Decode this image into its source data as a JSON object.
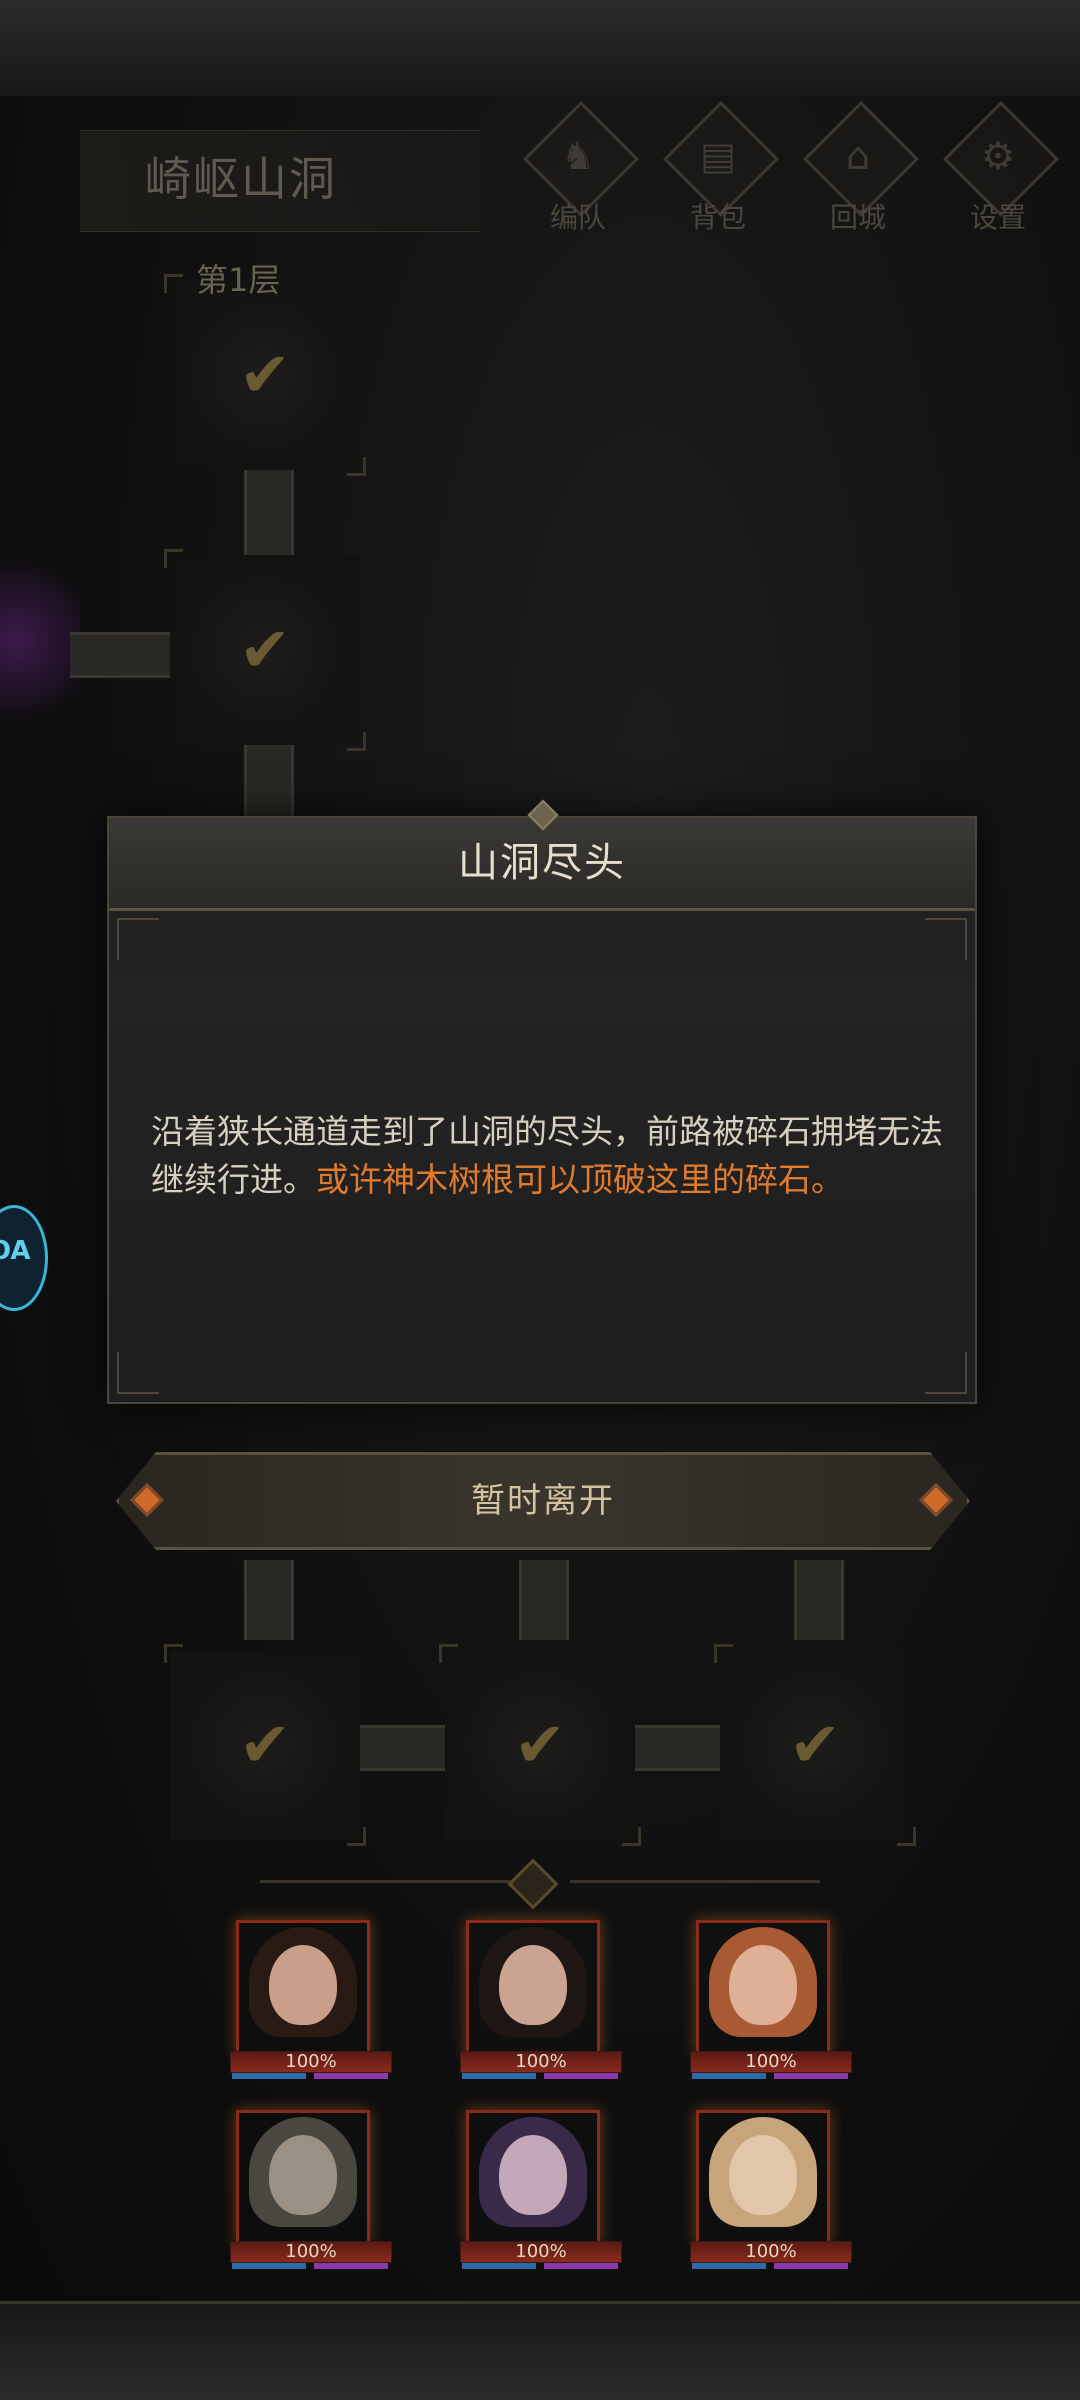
{
  "location": {
    "title": "崎岖山洞",
    "floor": "第1层"
  },
  "menu": [
    {
      "label": "编队",
      "icon": "formation-icon",
      "glyph": "♞"
    },
    {
      "label": "背包",
      "icon": "backpack-icon",
      "glyph": "▤"
    },
    {
      "label": "回城",
      "icon": "return-town-icon",
      "glyph": "⌂"
    },
    {
      "label": "设置",
      "icon": "settings-gear-icon",
      "glyph": "⚙"
    }
  ],
  "check_glyph": "✔",
  "dialog": {
    "title": "山洞尽头",
    "text_normal": "沿着狭长通道走到了山洞的尽头，前路被碎石拥堵无法继续行进。",
    "text_highlight": "或许神木树根可以顶破这里的碎石。",
    "highlight_color": "#e07b2e"
  },
  "leave_button": "暂时离开",
  "badge_text": "OA",
  "heroes": [
    {
      "hp": "100%",
      "skin": "#c8a08a",
      "hair": "#2a1a14"
    },
    {
      "hp": "100%",
      "skin": "#caa490",
      "hair": "#1e1612"
    },
    {
      "hp": "100%",
      "skin": "#e0b096",
      "hair": "#a85a34"
    },
    {
      "hp": "100%",
      "skin": "#9a9084",
      "hair": "#4a4640"
    },
    {
      "hp": "100%",
      "skin": "#c2a8b8",
      "hair": "#3a2a4a"
    },
    {
      "hp": "100%",
      "skin": "#e2c6a8",
      "hair": "#c8a47a"
    }
  ]
}
